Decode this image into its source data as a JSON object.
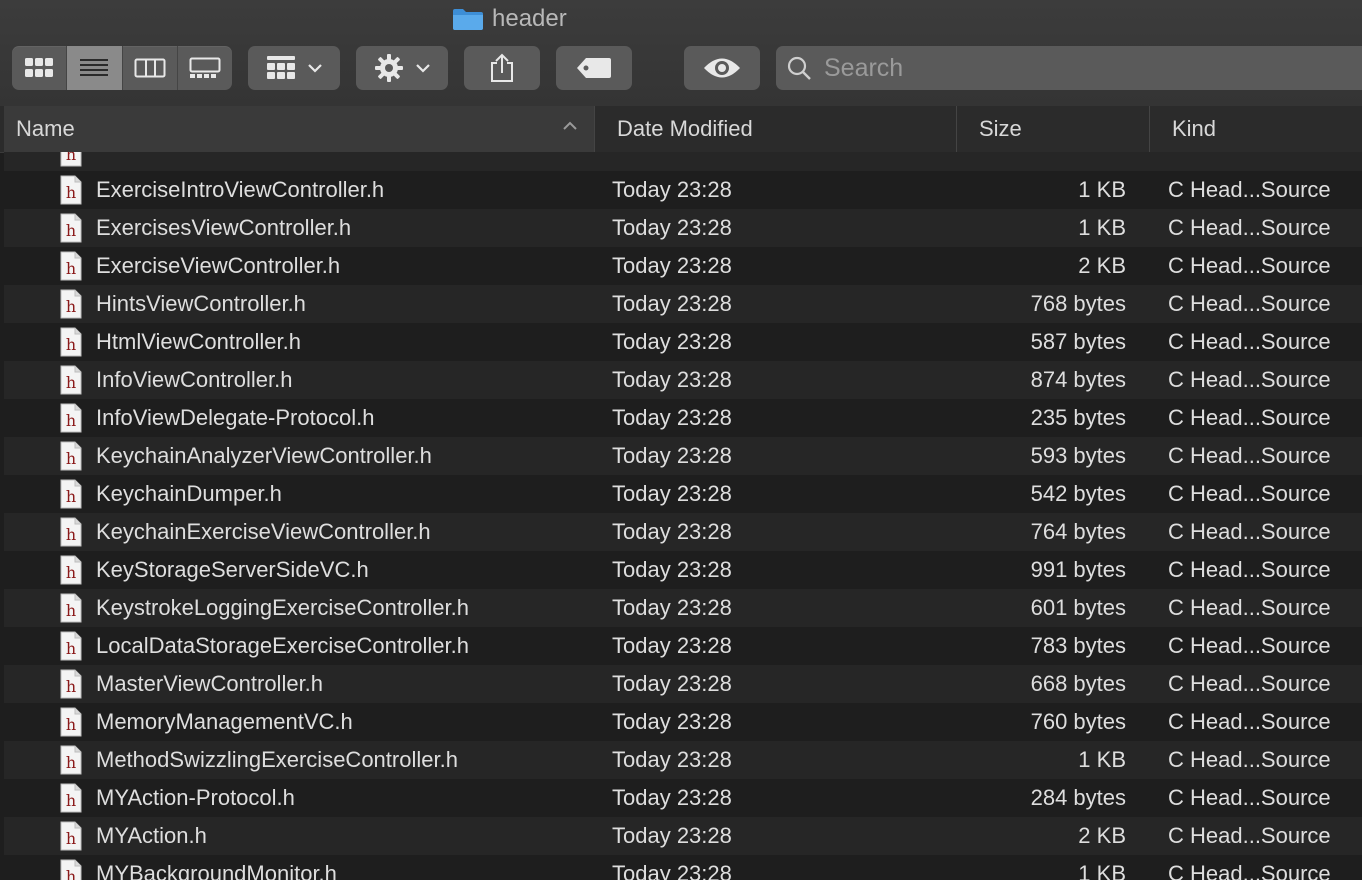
{
  "window": {
    "title": "header"
  },
  "toolbar": {
    "view_modes": [
      "icon-view",
      "list-view",
      "column-view",
      "gallery-view"
    ],
    "active_view": 1,
    "search_placeholder": "Search"
  },
  "columns": {
    "name": "Name",
    "date": "Date Modified",
    "size": "Size",
    "kind": "Kind"
  },
  "files": [
    {
      "name": "",
      "date": "",
      "size": "",
      "kind": ""
    },
    {
      "name": "ExerciseIntroViewController.h",
      "date": "Today 23:28",
      "size": "1 KB",
      "kind": "C Head...Source"
    },
    {
      "name": "ExercisesViewController.h",
      "date": "Today 23:28",
      "size": "1 KB",
      "kind": "C Head...Source"
    },
    {
      "name": "ExerciseViewController.h",
      "date": "Today 23:28",
      "size": "2 KB",
      "kind": "C Head...Source"
    },
    {
      "name": "HintsViewController.h",
      "date": "Today 23:28",
      "size": "768 bytes",
      "kind": "C Head...Source"
    },
    {
      "name": "HtmlViewController.h",
      "date": "Today 23:28",
      "size": "587 bytes",
      "kind": "C Head...Source"
    },
    {
      "name": "InfoViewController.h",
      "date": "Today 23:28",
      "size": "874 bytes",
      "kind": "C Head...Source"
    },
    {
      "name": "InfoViewDelegate-Protocol.h",
      "date": "Today 23:28",
      "size": "235 bytes",
      "kind": "C Head...Source"
    },
    {
      "name": "KeychainAnalyzerViewController.h",
      "date": "Today 23:28",
      "size": "593 bytes",
      "kind": "C Head...Source"
    },
    {
      "name": "KeychainDumper.h",
      "date": "Today 23:28",
      "size": "542 bytes",
      "kind": "C Head...Source"
    },
    {
      "name": "KeychainExerciseViewController.h",
      "date": "Today 23:28",
      "size": "764 bytes",
      "kind": "C Head...Source"
    },
    {
      "name": "KeyStorageServerSideVC.h",
      "date": "Today 23:28",
      "size": "991 bytes",
      "kind": "C Head...Source"
    },
    {
      "name": "KeystrokeLoggingExerciseController.h",
      "date": "Today 23:28",
      "size": "601 bytes",
      "kind": "C Head...Source"
    },
    {
      "name": "LocalDataStorageExerciseController.h",
      "date": "Today 23:28",
      "size": "783 bytes",
      "kind": "C Head...Source"
    },
    {
      "name": "MasterViewController.h",
      "date": "Today 23:28",
      "size": "668 bytes",
      "kind": "C Head...Source"
    },
    {
      "name": "MemoryManagementVC.h",
      "date": "Today 23:28",
      "size": "760 bytes",
      "kind": "C Head...Source"
    },
    {
      "name": "MethodSwizzlingExerciseController.h",
      "date": "Today 23:28",
      "size": "1 KB",
      "kind": "C Head...Source"
    },
    {
      "name": "MYAction-Protocol.h",
      "date": "Today 23:28",
      "size": "284 bytes",
      "kind": "C Head...Source"
    },
    {
      "name": "MYAction.h",
      "date": "Today 23:28",
      "size": "2 KB",
      "kind": "C Head...Source"
    },
    {
      "name": "MYBackgroundMonitor.h",
      "date": "Today 23:28",
      "size": "1 KB",
      "kind": "C Head...Source"
    }
  ]
}
